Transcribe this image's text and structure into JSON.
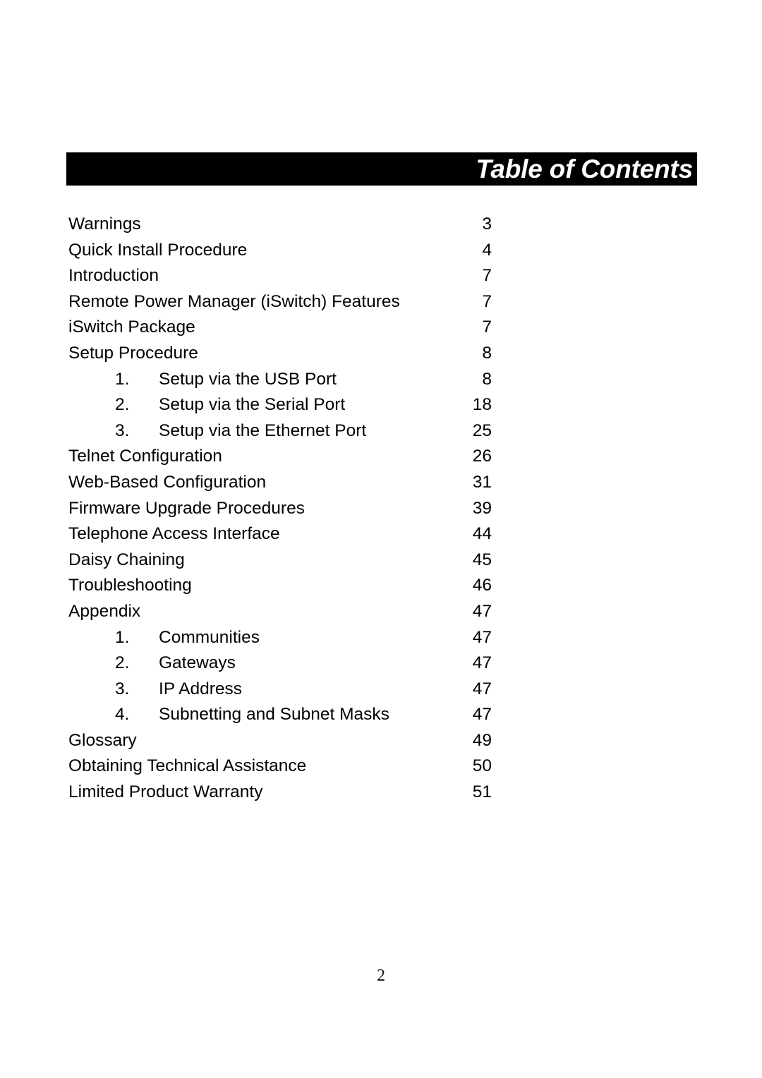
{
  "document": {
    "header": {
      "title": "Table of Contents",
      "bar_color": "#000000",
      "text_color": "#ffffff"
    },
    "footer": {
      "page_number": "2"
    },
    "toc": {
      "entries": [
        {
          "number": "",
          "label": "Warnings",
          "page": "3",
          "level": 0
        },
        {
          "number": "",
          "label": "Quick Install Procedure",
          "page": "4",
          "level": 0
        },
        {
          "number": "",
          "label": "Introduction",
          "page": "7",
          "level": 0
        },
        {
          "number": "",
          "label": "Remote Power Manager (iSwitch) Features",
          "page": "7",
          "level": 0
        },
        {
          "number": "",
          "label": "iSwitch Package",
          "page": "7",
          "level": 0
        },
        {
          "number": "",
          "label": "Setup Procedure",
          "page": "8",
          "level": 0
        },
        {
          "number": "1.",
          "label": "Setup via the USB Port",
          "page": "8",
          "level": 1
        },
        {
          "number": "2.",
          "label": "Setup via the Serial Port",
          "page": "18",
          "level": 1
        },
        {
          "number": "3.",
          "label": "Setup via the Ethernet Port",
          "page": "25",
          "level": 1
        },
        {
          "number": "",
          "label": "Telnet Configuration",
          "page": "26",
          "level": 0
        },
        {
          "number": "",
          "label": "Web-Based Configuration",
          "page": "31",
          "level": 0
        },
        {
          "number": "",
          "label": "Firmware Upgrade Procedures",
          "page": "39",
          "level": 0
        },
        {
          "number": "",
          "label": "Telephone Access Interface",
          "page": "44",
          "level": 0
        },
        {
          "number": "",
          "label": "Daisy Chaining",
          "page": "45",
          "level": 0
        },
        {
          "number": "",
          "label": "Troubleshooting",
          "page": "46",
          "level": 0
        },
        {
          "number": "",
          "label": "Appendix",
          "page": "47",
          "level": 0
        },
        {
          "number": "1.",
          "label": "Communities",
          "page": "47",
          "level": 1
        },
        {
          "number": "2.",
          "label": "Gateways",
          "page": "47",
          "level": 1
        },
        {
          "number": "3.",
          "label": "IP Address",
          "page": "47",
          "level": 1
        },
        {
          "number": "4.",
          "label": "Subnetting and Subnet Masks",
          "page": "47",
          "level": 1
        },
        {
          "number": "",
          "label": "Glossary",
          "page": "49",
          "level": 0
        },
        {
          "number": "",
          "label": "Obtaining Technical Assistance",
          "page": "50",
          "level": 0
        },
        {
          "number": "",
          "label": "Limited Product Warranty",
          "page": "51",
          "level": 0
        }
      ]
    }
  }
}
